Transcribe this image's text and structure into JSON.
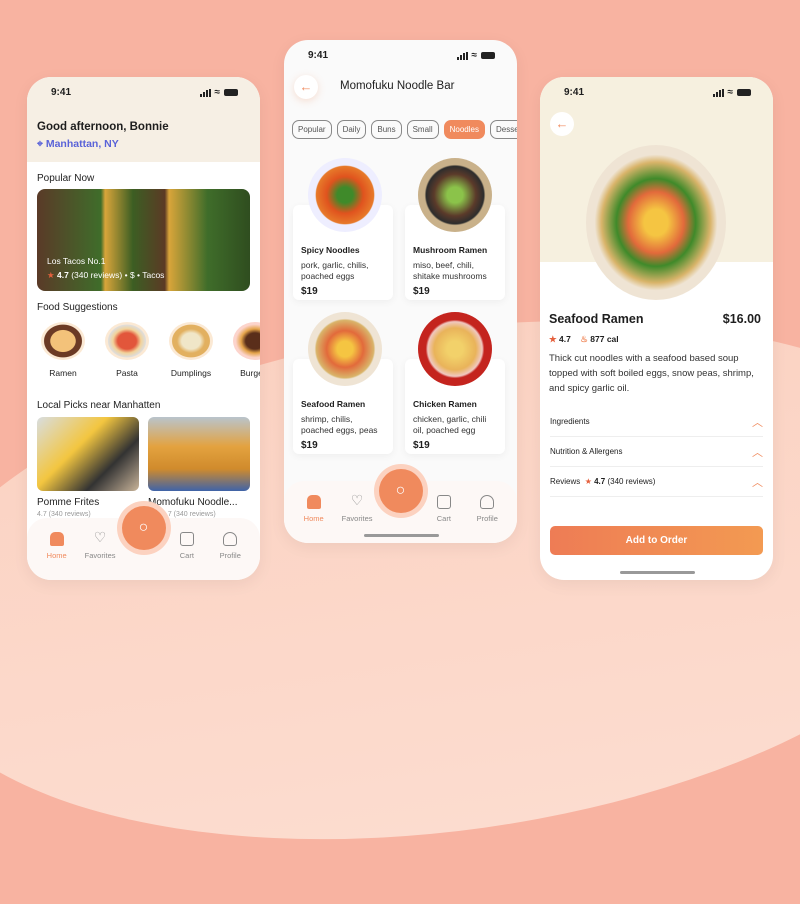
{
  "status_time": "9:41",
  "colors": {
    "accent": "#f08a5d",
    "background": "#f8b3a1",
    "location": "#5a63d8"
  },
  "home": {
    "greeting": "Good afternoon, Bonnie",
    "location": "Manhattan, NY",
    "popular_title": "Popular Now",
    "popular": {
      "name": "Los Tacos No.1",
      "rating": "4.7",
      "reviews": "(340 reviews)",
      "price": "$",
      "category": "Tacos"
    },
    "suggestions_title": "Food Suggestions",
    "suggestions": [
      {
        "label": "Ramen"
      },
      {
        "label": "Pasta"
      },
      {
        "label": "Dumplings"
      },
      {
        "label": "Burgers"
      }
    ],
    "local_title": "Local Picks near Manhatten",
    "local": [
      {
        "name": "Pomme Frites",
        "meta": "4.7 (340 reviews)"
      },
      {
        "name": "Momofuku Noodle...",
        "meta": "4.7 (340 reviews)"
      }
    ]
  },
  "nav": {
    "home": "Home",
    "favorites": "Favorites",
    "cart": "Cart",
    "profile": "Profile"
  },
  "menu": {
    "title": "Momofuku Noodle Bar",
    "tabs": [
      {
        "label": "Popular"
      },
      {
        "label": "Daily"
      },
      {
        "label": "Buns"
      },
      {
        "label": "Small"
      },
      {
        "label": "Noodles",
        "active": true
      },
      {
        "label": "Desserts"
      }
    ],
    "items": [
      {
        "name": "Spicy Noodles",
        "desc": "pork, garlic, chilis, poached eggs",
        "price": "$19"
      },
      {
        "name": "Mushroom Ramen",
        "desc": "miso, beef, chili, shitake mushrooms",
        "price": "$19"
      },
      {
        "name": "Seafood Ramen",
        "desc": "shrimp, chilis, poached eggs, peas",
        "price": "$19"
      },
      {
        "name": "Chicken Ramen",
        "desc": "chicken, garlic, chili oil, poached egg",
        "price": "$19"
      }
    ]
  },
  "detail": {
    "name": "Seafood Ramen",
    "price": "$16.00",
    "rating": "4.7",
    "calories": "877 cal",
    "description": "Thick cut noodles with a seafood based soup topped with soft boiled eggs, snow peas, shrimp, and spicy garlic oil.",
    "sections": [
      {
        "label": "Ingredients"
      },
      {
        "label": "Nutrition & Allergens"
      },
      {
        "label": "Reviews"
      }
    ],
    "reviews_rating": "4.7",
    "reviews_count": "(340 reviews)",
    "cta": "Add to Order"
  }
}
